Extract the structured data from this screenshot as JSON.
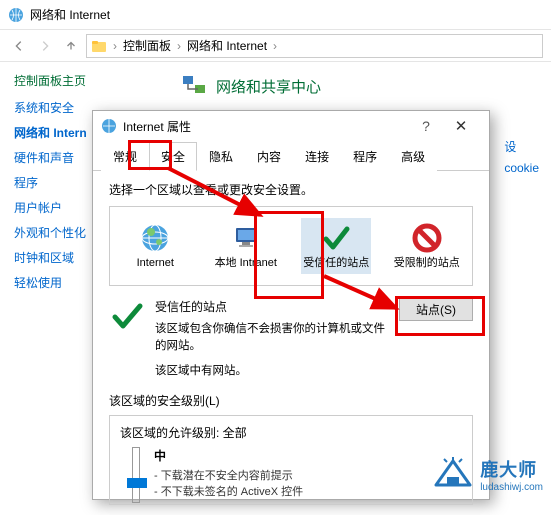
{
  "cp": {
    "title": "网络和 Internet",
    "crumb1": "控制面板",
    "crumb2": "网络和 Internet",
    "home": "控制面板主页",
    "links": [
      "系统和安全",
      "网络和 Intern",
      "硬件和声音",
      "程序",
      "用户帐户",
      "外观和个性化",
      "时钟和区域",
      "轻松使用"
    ],
    "heading": "网络和共享中心",
    "rightLinks": [
      "设",
      "cookie"
    ]
  },
  "dialog": {
    "title": "Internet 属性",
    "tabs": [
      "常规",
      "安全",
      "隐私",
      "内容",
      "连接",
      "程序",
      "高级"
    ],
    "activeTab": 1,
    "zonePrompt": "选择一个区域以查看或更改安全设置。",
    "zones": [
      {
        "label": "Internet"
      },
      {
        "label": "本地 Intranet"
      },
      {
        "label": "受信任的站点"
      },
      {
        "label": "受限制的站点"
      }
    ],
    "selectedZone": 2,
    "trusted": {
      "title": "受信任的站点",
      "desc": "该区域包含你确信不会损害你的计算机或文件的网站。",
      "sub": "该区域中有网站。",
      "sitesBtn": "站点(S)"
    },
    "level": {
      "title": "该区域的安全级别(L)",
      "allow": "该区域的允许级别: 全部",
      "name": "中",
      "bullets": [
        "- 下载潜在不安全内容前提示",
        "- 不下载未签名的 ActiveX 控件"
      ]
    }
  },
  "watermark": {
    "brand": "鹿大师",
    "url": "ludashiwj.com"
  }
}
